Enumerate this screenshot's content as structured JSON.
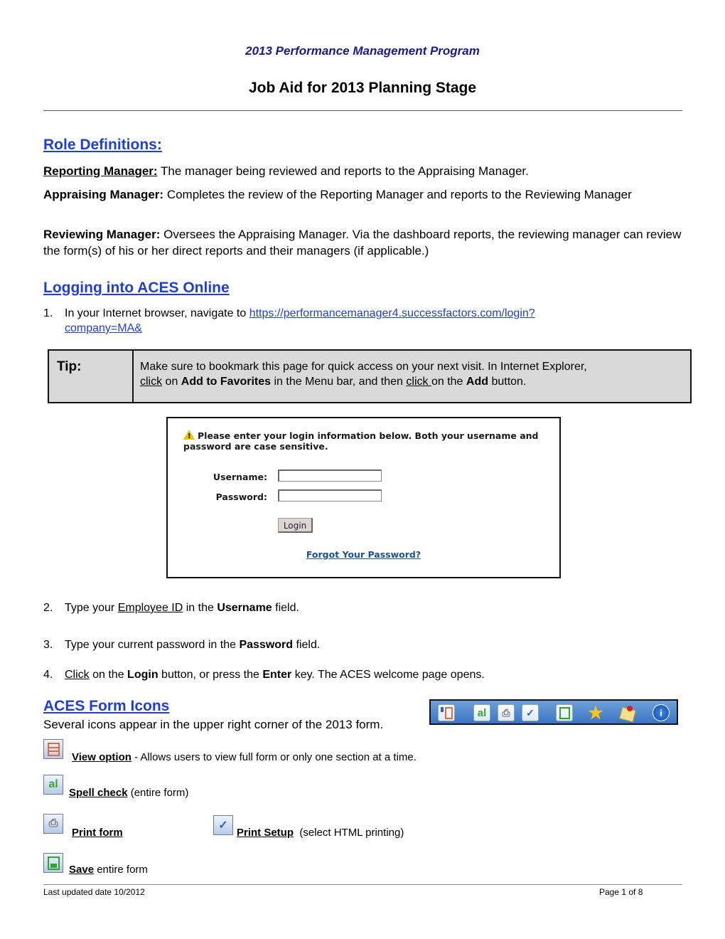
{
  "header": {
    "program_title": "2013 Performance Management Program",
    "document_title": "Job Aid for 2013 Planning Stage"
  },
  "role_definitions": {
    "heading": "Role Definitions:",
    "roles": [
      {
        "term": "Reporting Manager:",
        "text": " The manager being reviewed and reports to the Appraising Manager."
      },
      {
        "term": "Appraising Manager:",
        "text": " Completes the review of the Reporting Manager and reports to the Reviewing Manager"
      },
      {
        "term": "Reviewing Manager:",
        "text": " Oversees the Appraising Manager.  Via the dashboard reports, the reviewing manager can review the form(s) of his or her direct reports and their managers (if applicable.)"
      }
    ]
  },
  "logging_in": {
    "heading": "Logging into ACES Online",
    "step1": {
      "num": "1.",
      "prefix": "In your Internet browser, navigate to ",
      "link_line1": "https://performancemanager4.successfactors.com/login?",
      "link_line2": "company=MA&"
    },
    "tip": {
      "label": "Tip:",
      "t1": "Make sure to bookmark this page for quick access on your next visit.  In Internet Explorer,",
      "click1": "click",
      "t2": " on ",
      "b1": "Add to Favorites",
      "t3": " in the Menu bar, and then ",
      "click2": "click ",
      "t4": "on the ",
      "b2": "Add",
      "t5": " button."
    },
    "login_screenshot": {
      "message": "Please enter your login information below. Both your username and password are case sensitive.",
      "username_label": "Username:",
      "username_value": "",
      "password_label": "Password:",
      "password_value": "",
      "login_button": "Login",
      "forgot_link": "Forgot Your Password?"
    },
    "step2": {
      "num": "2.",
      "t1": "Type your ",
      "u1": "Employee ID",
      "t2": " in the ",
      "b1": "Username",
      "t3": " field."
    },
    "step3": {
      "num": "3.",
      "t1": "Type your current password in the ",
      "b1": "Password",
      "t2": " field."
    },
    "step4": {
      "num": "4.",
      "u1": "Click",
      "t1": " on the ",
      "b1": "Login",
      "t2": " button, or press the ",
      "b2": "Enter",
      "t3": " key.  The ACES welcome page opens."
    }
  },
  "form_icons": {
    "heading": "ACES Form Icons",
    "intro": "Several icons appear in the upper right corner of the 2013 form.",
    "toolbar_icons": [
      "view-option-icon",
      "spell-check-icon",
      "print-icon",
      "print-setup-icon",
      "save-icon",
      "favorite-star-icon",
      "notes-pin-icon",
      "info-icon"
    ],
    "items": [
      {
        "icon": "view-option-icon",
        "label": "View option",
        "desc": " - Allows users to view full form or only one section at a time."
      },
      {
        "icon": "spell-check-icon",
        "label": "Spell check",
        "desc": " (entire form)"
      },
      {
        "icon": "print-icon",
        "label": "Print form",
        "desc": ""
      },
      {
        "icon": "print-setup-icon",
        "label": "Print Setup",
        "desc": "  (select HTML printing)"
      },
      {
        "icon": "save-icon",
        "label": "Save",
        "desc": " entire form"
      }
    ]
  },
  "footer": {
    "updated": "Last updated date 10/2012",
    "page": "Page 1 of 8"
  }
}
